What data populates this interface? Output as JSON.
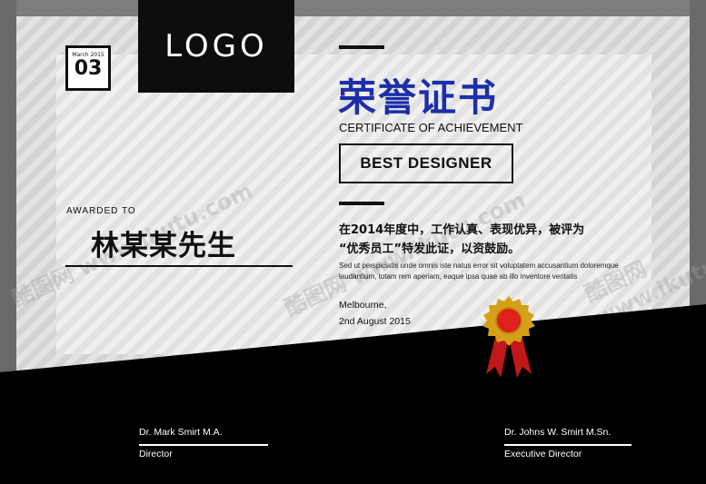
{
  "logo": {
    "text": "LOGO"
  },
  "date_badge": {
    "month": "March 2015",
    "day": "03"
  },
  "title": {
    "chinese": "荣誉证书",
    "english": "CERTIFICATE OF ACHIEVEMENT"
  },
  "award": {
    "label": "BEST DESIGNER"
  },
  "recipient": {
    "awarded_label": "AWARDED TO",
    "name": "林某某先生"
  },
  "body": {
    "line1": "在2014年度中，工作认真、表现优异，被评为",
    "line2": "“优秀员工”特发此证，以资鼓励。",
    "lorem": "Sed ut perspiciatis unde omnis iste natus error sit voluptatem accusantium doloremque laudantium, totam rem aperiam, eaque ipsa quae ab illo inventore veritatis"
  },
  "issue": {
    "place": "Melbourne,",
    "date": "2nd August 2015"
  },
  "signatures": [
    {
      "name": "Dr. Mark Smirt M.A.",
      "role": "Director"
    },
    {
      "name": "Dr. Johns W. Smirt M.Sn.",
      "role": "Executive Director"
    }
  ],
  "watermark": {
    "text": "酷图网 www.ikutu.com"
  },
  "colors": {
    "title_blue": "#1c2fa8",
    "medal_gold": "#d4a017",
    "medal_red": "#e0201b",
    "background_dark": "#000000"
  }
}
